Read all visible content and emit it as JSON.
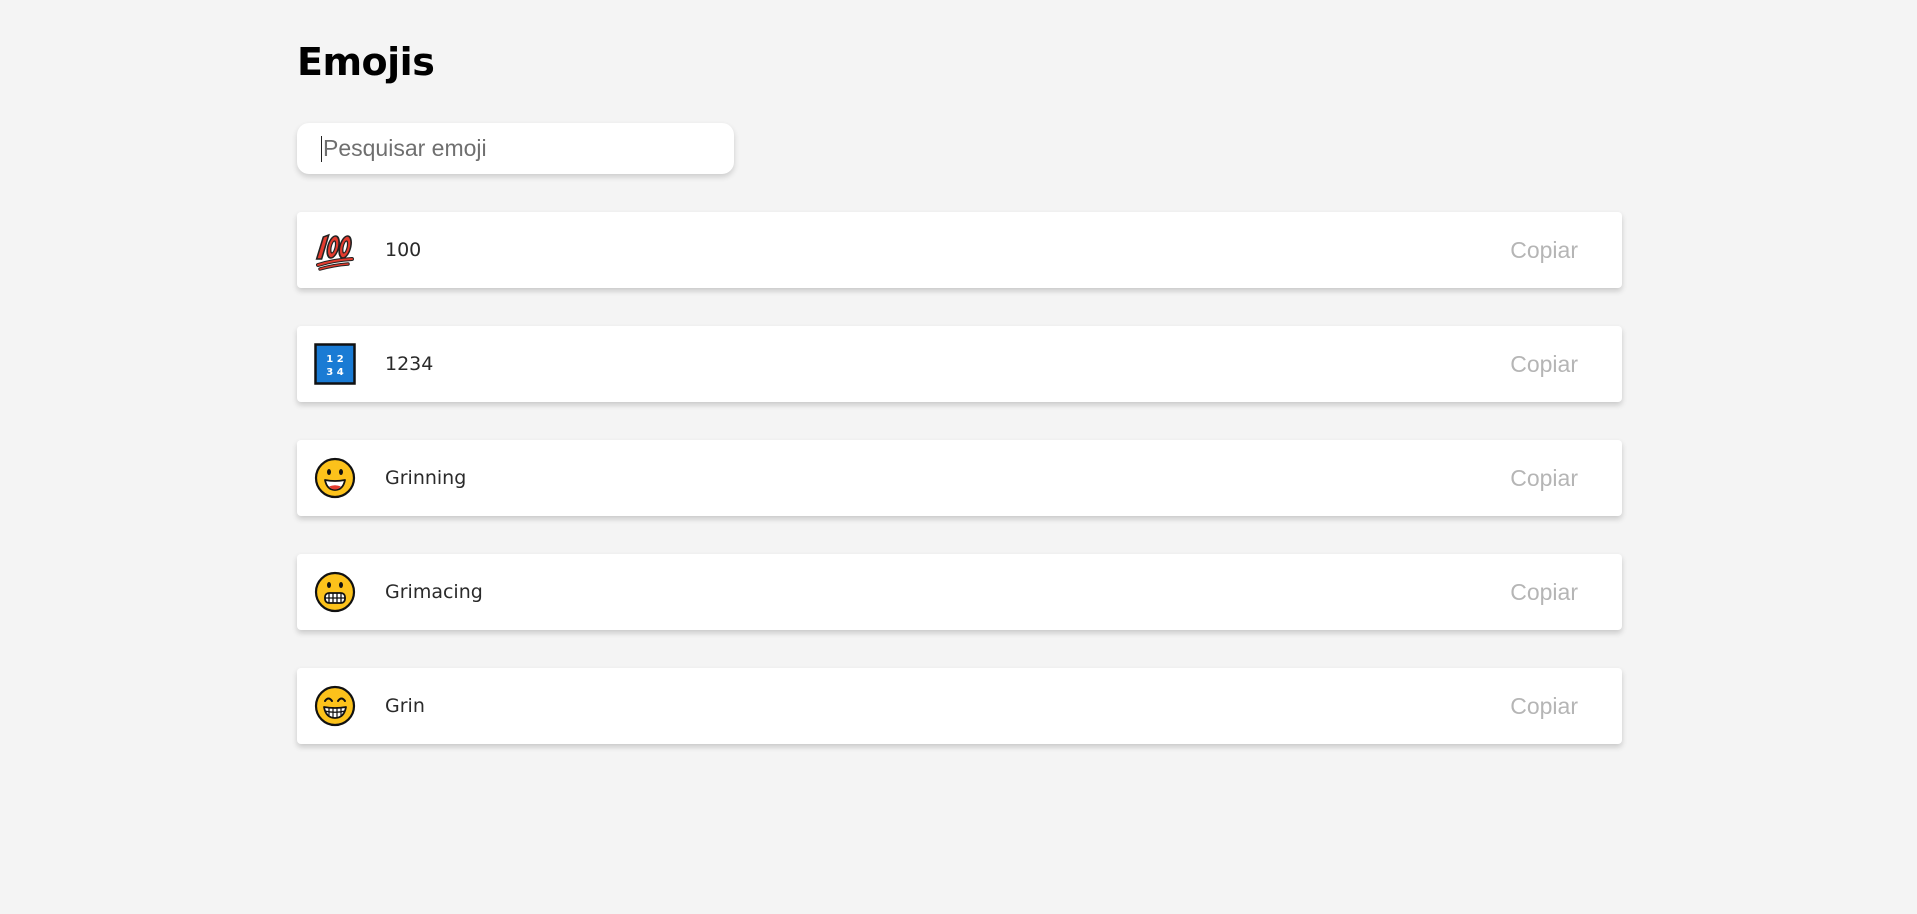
{
  "page": {
    "title": "Emojis"
  },
  "search": {
    "placeholder": "Pesquisar emoji",
    "value": ""
  },
  "emojis": [
    {
      "name": "100",
      "icon": "hundred-points-icon",
      "copy_label": "Copiar"
    },
    {
      "name": "1234",
      "icon": "input-numbers-icon",
      "copy_label": "Copiar"
    },
    {
      "name": "Grinning",
      "icon": "grinning-face-icon",
      "copy_label": "Copiar"
    },
    {
      "name": "Grimacing",
      "icon": "grimacing-face-icon",
      "copy_label": "Copiar"
    },
    {
      "name": "Grin",
      "icon": "grin-face-icon",
      "copy_label": "Copiar"
    }
  ],
  "colors": {
    "background": "#f4f4f4",
    "card": "#ffffff",
    "copy_text": "#b5b5b5",
    "emoji_yellow": "#fcc21b",
    "emoji_red": "#e23b2e",
    "keycap_blue": "#1a7bd4"
  }
}
